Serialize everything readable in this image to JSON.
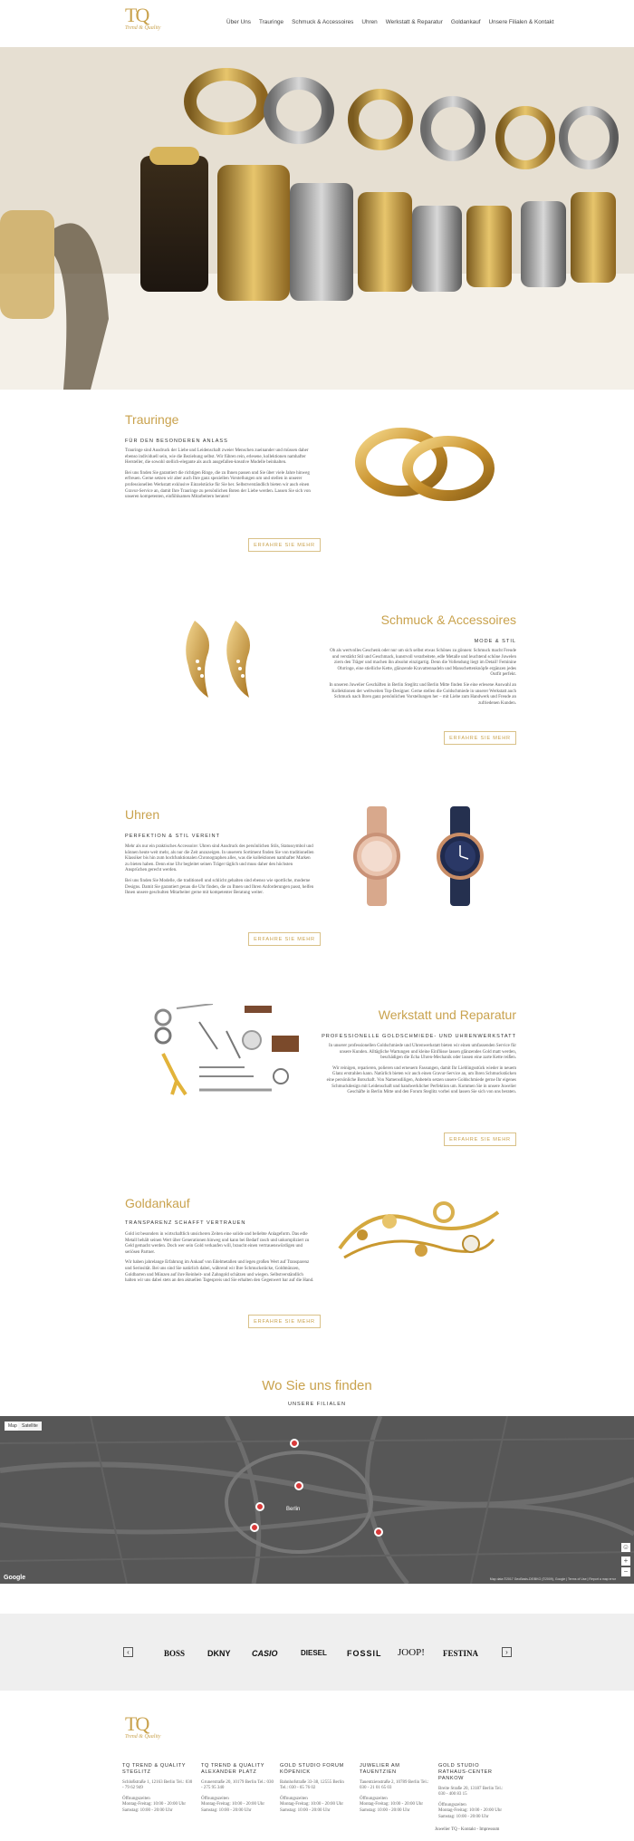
{
  "nav": {
    "items": [
      "Über Uns",
      "Trauringe",
      "Schmuck & Accessoires",
      "Uhren",
      "Werkstatt & Reparatur",
      "Goldankauf",
      "Unsere Filialen & Kontakt"
    ]
  },
  "logo": {
    "letters": "TQ",
    "tagline": "Trend & Quality"
  },
  "sections": {
    "trauringe": {
      "title": "Trauringe",
      "subtitle": "FÜR DEN BESONDEREN ANLASS",
      "p1": "Trauringe sind Ausdruck der Liebe und Leidenschaft zweier Menschen zueinander und müssen daher ebenso individuell sein, wie die Beziehung selbst. Wir führen rein, erlesene, kollektionen namhafter Hersteller, die sowohl stellich-elegante als auch ausgefallen-kreative Modelle beinhalten.",
      "p2": "Bei uns finden Sie garantiert die richtigen Ringe, die zu Ihnen passen und Sie über viele Jahre hinweg erfreuen. Gerne setzen wir aber auch Ihre ganz speziellen Vorstellungen um und stellen in unserer professionellen Werkstatt exklusive Einzelstücke für Sie her. Selbstverständlich bieten wir auch einen Gravur-Service an, damit Ihre Trauringe zu persönlichen Boten der Liebe werden. Lassen Sie sich von unseren kompetenten, einfühlsamen Mitarbeitern beraten!",
      "button": "ERFAHRE SIE MEHR"
    },
    "schmuck": {
      "title": "Schmuck & Accessoires",
      "subtitle": "MODE & STIL",
      "p1": "Ob als wertvolles Geschenk oder nur um sich selbst etwas Schönes zu gönnen: Schmuck macht Freude und verstärkt Stil und Geschmack, kunstvoll verarbeitete, edle Metalle und leuchtend schöne Juwelen ziern den Träger und machen ihn absolut einzigartig. Denn die Vollendung liegt im Detail! Feminine Ohrringe, eine stielliche Kette, glänzende Kravattennadeln und Manschettenknöpfe ergänzen jedes Outfit perfekt.",
      "p2": "In unseren Juwelier Geschäften in Berlin Steglitz und Berlin Mitte finden Sie eine erlesene Auswahl an Kollektionen der weltweiten Top-Designer. Gerne stellen die Goldschmiede in unserer Werkstatt auch Schmuck nach Ihren ganz persönlichen Vorstellungen her – mit Liebe zum Handwerk und Freude an zufriedenen Kunden.",
      "button": "ERFAHRE SIE MEHR"
    },
    "uhren": {
      "title": "Uhren",
      "subtitle": "PERFEKTION & STIL VEREINT",
      "p1": "Mehr als nur ein praktisches Accessoire: Uhren sind Ausdruck des persönlichen Stils, Statussymbol und können heute weit mehr, als nur die Zeit anzuzeigen. In unserem Sortiment finden Sie von traditionellen Klassiker bis hin zum hochfunktionalen Chronographen alles, was die kollektionen namhafter Marken zu bieten haben. Denn eine Uhr begleitet seinen Träger täglich und muss daher den höchsten Ansprüchen gerecht werden.",
      "p2": "Bei uns finden Sie Modelle, die traditionell und schlicht gehalten sind ebenso wie sportliche, moderne Designs. Damit Sie garantiert genau die Uhr finden, die zu Ihnen und Ihren Anforderungen passt, helfen Ihnen unsere geschulten Mitarbeiter gerne mit kompetenter Beratung weiter.",
      "button": "ERFAHRE SIE MEHR"
    },
    "werkstatt": {
      "title": "Werkstatt und Reparatur",
      "subtitle": "PROFESSIONELLE GOLDSCHMIEDE- UND UHRENWERKSTATT",
      "p1": "In unserer professionellen Goldschmiede und Uhrenwerkstatt bieten wir einen umfassenden Service für unsere Kunden. Alltägliche Wartungen und kleine Einflüsse lassen glänzendes Gold matt werden, beschädigen die Echa Uhren-Mechanik oder lassen eine zarte Kette reißen.",
      "p2": "Wir reinigen, reparieren, polieren und erneuern Fassungen, damit Ihr Lieblingsstück wieder in neuem Glanz erstrahlen kann. Natürlich bieten wir auch einen Gravur-Service an, um Ihren Schmuckstücken eine persönliche Botschaft. Von Namensdiligen, Anbeteln setzen unsere Goldschmiede gerne Ihr eigenes Schmuckdesign mit Leidenschaft und handwerklicher Perfektion um. Kommen Sie in unsere Juwelier Geschäfte in Berlin Mitte und den Forum Steglitz vorbei und lassen Sie sich von uns beraten.",
      "button": "ERFAHRE SIE MEHR"
    },
    "goldankauf": {
      "title": "Goldankauf",
      "subtitle": "TRANSPARENZ SCHAFFT VERTRAUEN",
      "p1": "Gold ist besonders in wirtschaftlich unsicheren Zeiten eine solide und beliebte Anlageform. Das edle Metall behält seinen Wert über Generationen hinweg und kann bei Bedarf rasch und unkompliziert zu Geld gemacht werden. Doch wer sein Gold verkaufen will, braucht einen vertrauenswürdigen und seriösen Partner.",
      "p2": "Wir haben jahrelange Erfahrung im Ankauf von Edelmetallen und legen großen Wert auf Transparenz und Seriosität. Bei uns sind Sie natürlich dabei, während wir Ihre Schmuckstücke, Goldmünzen, Goldbarren und Münzen auf ihre Reinheit- und Zahngold schätzen und wiegen. Selbstverständlich halten wir uns dabei stets an den aktuellen Tagespreis und Sie erhalten den Gegenwert bar auf die Hand.",
      "button": "ERFAHRE SIE MEHR"
    }
  },
  "location": {
    "title": "Wo Sie uns finden",
    "subtitle": "UNSERE FILIALEN",
    "map_tabs": [
      "Map",
      "Satellite"
    ],
    "city_label": "Berlin",
    "google": "Google",
    "attribution": "Map data ©2017 GeoBasis-DE/BKG (©2009), Google | Terms of Use | Report a map error"
  },
  "brands": {
    "items": [
      "BOSS",
      "DKNY",
      "CASIO",
      "DIESEL",
      "FOSSIL",
      "JOOP!",
      "FESTINA"
    ],
    "prev": "‹",
    "next": "›"
  },
  "footer": {
    "columns": [
      {
        "title": "TQ TREND & QUALITY STEGLITZ",
        "address": "Schloßstraße 1, 12163 Berlin Tel.: 030 - 79 62 949",
        "hours_title": "Öffnungszeiten",
        "hours": "Montag-Freitag: 10:00 - 20:00 Uhr Samstag: 10:00 - 20:00 Uhr"
      },
      {
        "title": "TQ TREND & QUALITY ALEXANDER PLATZ",
        "address": "Grunerstraße 20, 10179 Berlin Tel.: 030 - 275 95 340",
        "hours_title": "Öffnungszeiten",
        "hours": "Montag-Freitag: 10:00 - 20:00 Uhr Samstag: 10:00 - 20:00 Uhr"
      },
      {
        "title": "GOLD STUDIO FORUM KÖPENICK",
        "address": "Bahnhofstraße 33-38, 12555 Berlin Tel.: 030 - 65 76 02",
        "hours_title": "Öffnungszeiten",
        "hours": "Montag-Freitag: 10:00 - 20:00 Uhr Samstag: 10:00 - 20:00 Uhr"
      },
      {
        "title": "JUWELIER AM TAUENTZIEN",
        "address": "Tauentzienstraße 2, 10789 Berlin Tel.: 030 - 21 01 65 03",
        "hours_title": "Öffnungszeiten",
        "hours": "Montag-Freitag: 10:00 - 20:00 Uhr Samstag: 10:00 - 20:00 Uhr"
      },
      {
        "title": "GOLD STUDIO RATHAUS-CENTER PANKOW",
        "address": "Breite Straße 20, 13187 Berlin Tel.: 030 - 400 83 15",
        "hours_title": "Öffnungszeiten",
        "hours": "Montag-Freitag: 10:00 - 20:00 Uhr Samstag: 10:00 - 20:00 Uhr"
      }
    ],
    "bottom_links": "Juwelier TQ - Kontakt - Impressum"
  },
  "colors": {
    "gold": "#c9a24d",
    "text": "#444444",
    "map": "#5a5a5a",
    "brand_bar": "#efefef"
  }
}
